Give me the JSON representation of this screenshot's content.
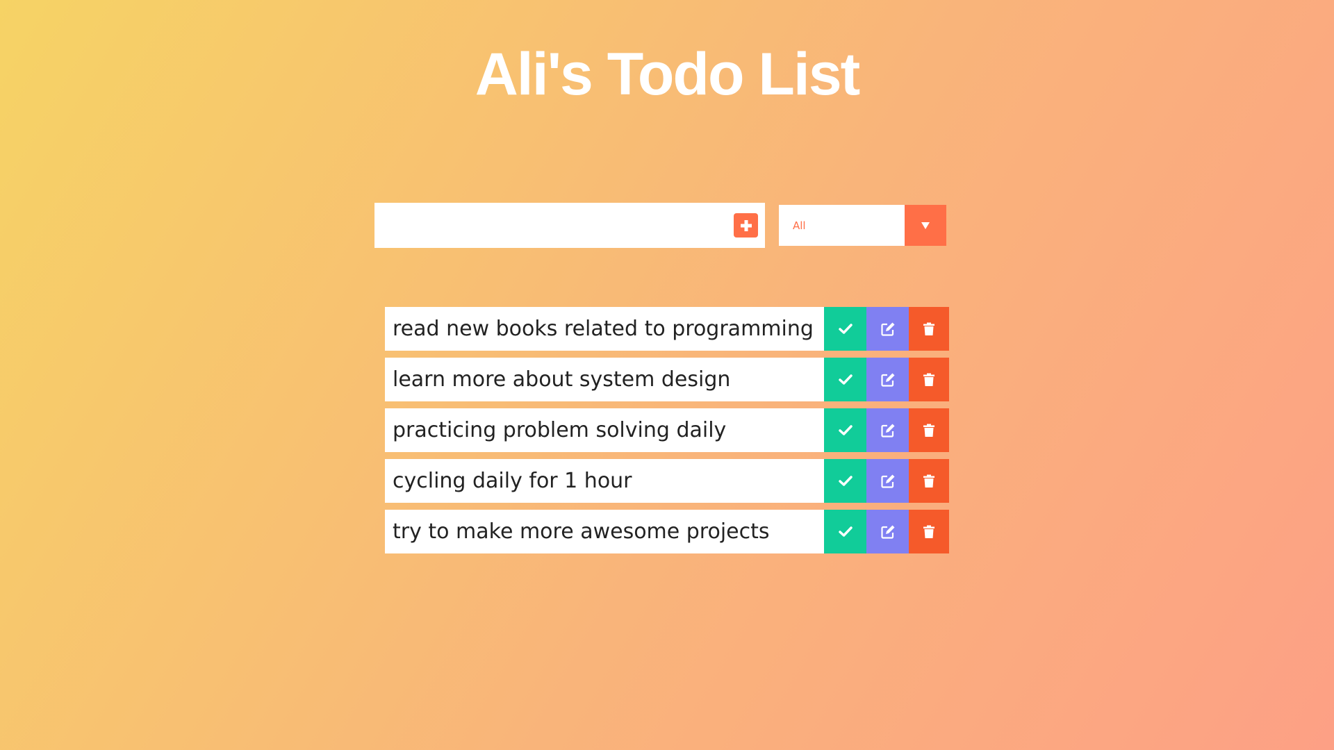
{
  "header": {
    "title": "Ali's Todo List"
  },
  "form": {
    "input_value": "",
    "input_placeholder": "",
    "add_icon": "plus-square-icon",
    "filter_selected": "All",
    "filter_arrow_icon": "caret-down-icon"
  },
  "todos": [
    {
      "text": "read new books related to programming"
    },
    {
      "text": "learn more about system design"
    },
    {
      "text": "practicing problem solving daily"
    },
    {
      "text": "cycling daily for 1 hour"
    },
    {
      "text": "try to make more awesome projects"
    }
  ],
  "actions": {
    "complete_icon": "check-icon",
    "edit_icon": "edit-icon",
    "delete_icon": "trash-icon"
  },
  "colors": {
    "background_start": "#f6d365",
    "background_end": "#fda085",
    "accent": "#ff6f47",
    "complete": "#11cc99",
    "edit": "#8080f2",
    "delete": "#f55a2a"
  }
}
